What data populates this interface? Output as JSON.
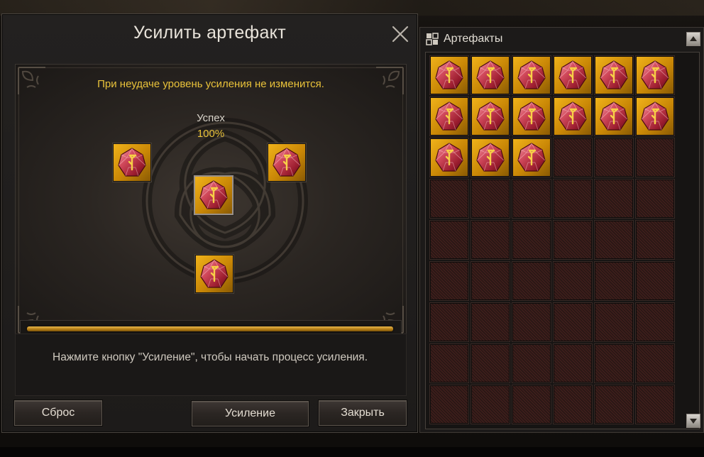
{
  "enhance_window": {
    "title": "Усилить артефакт",
    "notice": "При неудаче уровень усиления не изменится.",
    "success_label": "Успех",
    "success_value": "100%",
    "progress": 1.0,
    "hint": "Нажмите кнопку \"Усиление\", чтобы начать процесс усиления.",
    "buttons": {
      "reset": "Сброс",
      "enhance": "Усиление",
      "close": "Закрыть"
    },
    "slots": [
      "artifact-red-rune",
      "artifact-red-rune",
      "artifact-red-rune",
      "artifact-red-rune"
    ]
  },
  "artifacts_panel": {
    "title": "Артефакты",
    "columns": 6,
    "rows": 9,
    "filled_count": 15,
    "item_icon": "red-rune-crystal-icon"
  },
  "colors": {
    "accent_gold": "#e9c23a",
    "slot_gold": "#d99a0e",
    "crystal_red": "#b8283a",
    "rune_gold": "#f2c23c"
  }
}
